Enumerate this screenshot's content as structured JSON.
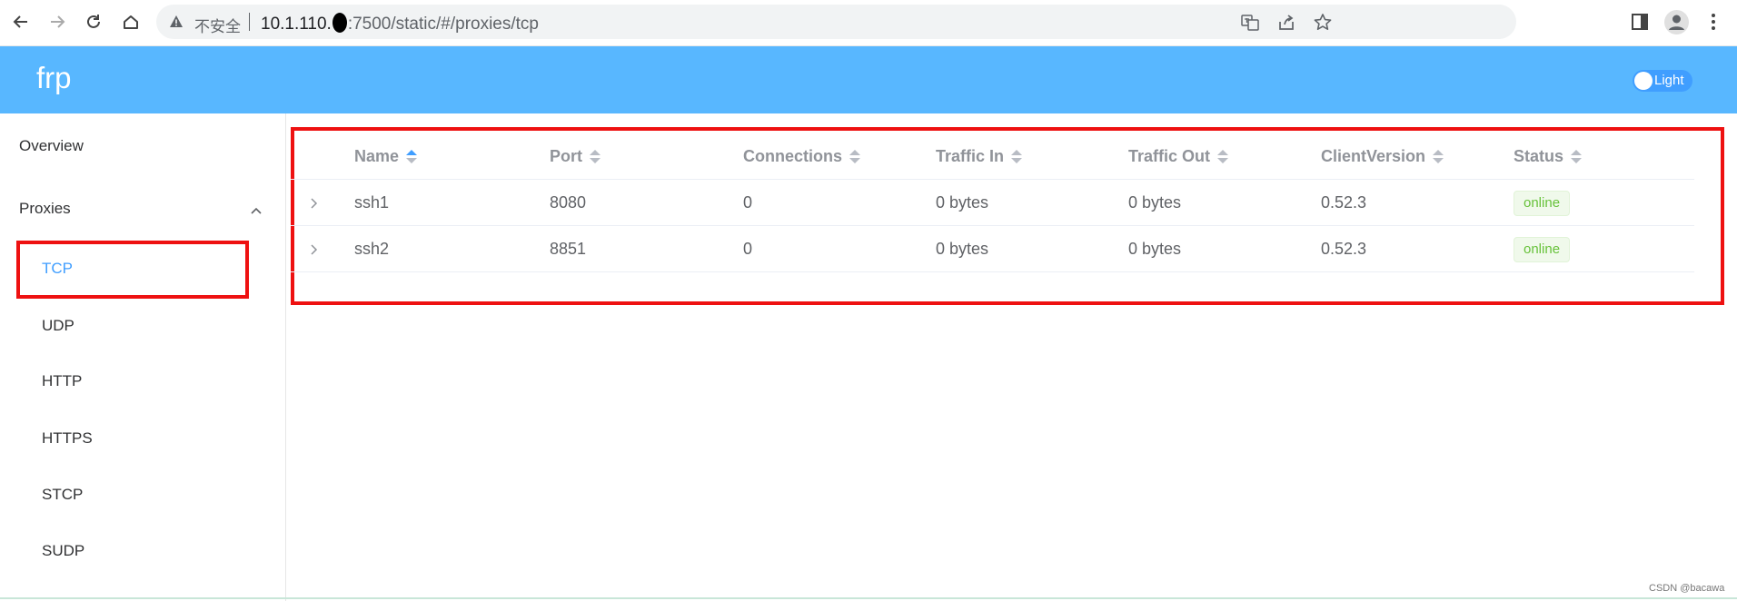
{
  "browser": {
    "insecure_label": "不安全",
    "url_host": "10.1.110.",
    "url_rest": ":7500/static/#/proxies/tcp"
  },
  "app": {
    "brand": "frp",
    "theme_label": "Light"
  },
  "sidebar": {
    "overview": "Overview",
    "proxies": "Proxies",
    "items": [
      "TCP",
      "UDP",
      "HTTP",
      "HTTPS",
      "STCP",
      "SUDP"
    ],
    "active": "TCP"
  },
  "table": {
    "columns": [
      "Name",
      "Port",
      "Connections",
      "Traffic In",
      "Traffic Out",
      "ClientVersion",
      "Status"
    ],
    "rows": [
      {
        "name": "ssh1",
        "port": "8080",
        "connections": "0",
        "traffic_in": "0 bytes",
        "traffic_out": "0 bytes",
        "client_version": "0.52.3",
        "status": "online"
      },
      {
        "name": "ssh2",
        "port": "8851",
        "connections": "0",
        "traffic_in": "0 bytes",
        "traffic_out": "0 bytes",
        "client_version": "0.52.3",
        "status": "online"
      }
    ]
  },
  "colors": {
    "header": "#58b7ff",
    "accent": "#409eff",
    "online": "#67c23a",
    "highlight": "#ee1111"
  },
  "watermark": "CSDN @bacawa"
}
